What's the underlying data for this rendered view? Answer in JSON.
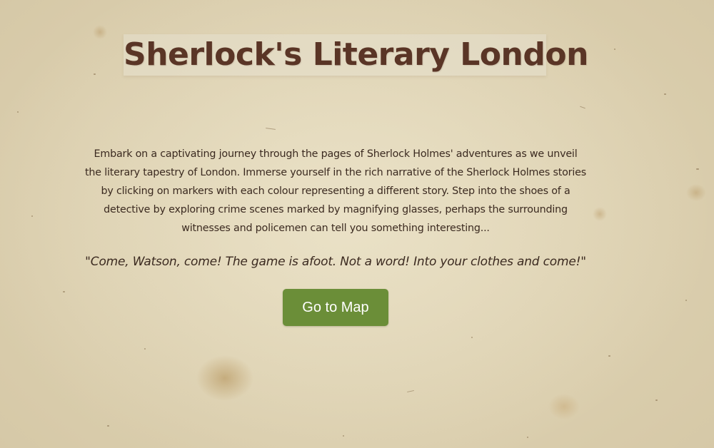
{
  "page": {
    "title": "Sherlock's Literary London",
    "intro": "Embark on a captivating journey through the pages of Sherlock Holmes' adventures as we unveil the literary tapestry of London. Immerse yourself in the rich narrative of the Sherlock Holmes stories by clicking on markers with each colour representing a different story. Step into the shoes of a detective by exploring crime scenes marked by magnifying glasses, perhaps the surrounding witnesses and policemen can tell you something interesting...",
    "quote": "\"Come, Watson, come! The game is afoot. Not a word! Into your clothes and come!\"",
    "button_label": "Go to Map"
  },
  "colors": {
    "background": "#e3d8b9",
    "title": "#5a3526",
    "text": "#3b2a20",
    "button": "#6b8e38",
    "button_text": "#ffffff"
  }
}
